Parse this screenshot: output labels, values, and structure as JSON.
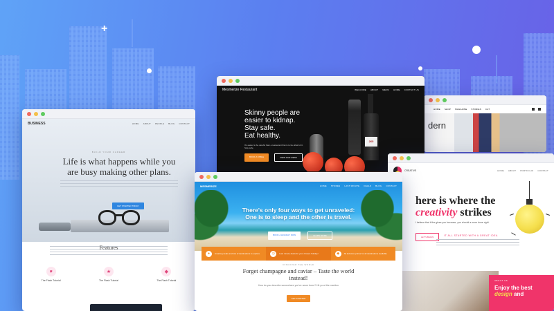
{
  "w1": {
    "logo": "BUSINESS",
    "menu": [
      "HOME",
      "ABOUT",
      "PEOPLE",
      "BLOG",
      "CONTACT"
    ],
    "eyebrow": "BUILD YOUR CAREER",
    "headline": "Life is what happens while you are busy making other plans.",
    "cta": "GET STARTED TODAY",
    "features_title": "Features",
    "features": [
      "The Flash Tutorial",
      "The Flash Tutorial",
      "The Flash Tutorial"
    ]
  },
  "w2": {
    "logo": "Mesmerize Restaurant",
    "menu": [
      "WELCOME",
      "ABOUT",
      "MENU",
      "HOME",
      "CONTACT US"
    ],
    "headline_lines": [
      "Skinny people are",
      "easier to kidnap.",
      "Stay safe.",
      "Eat healthy."
    ],
    "sub": "It's easier to be careful than a restaurant that is to be afraid of it. Stay safe.",
    "btn1": "BOOK A TABLE",
    "btn2": "VIEW OUR MENU",
    "bottle_label": "265"
  },
  "w3": {
    "menu": [
      "HOME",
      "SHOP",
      "MAGAZINE",
      "STORIES",
      "CAT"
    ],
    "partial_text": "dern"
  },
  "w4": {
    "logo": "MESMERIZE",
    "menu": [
      "HOME",
      "STORES",
      "LAST MINUTE",
      "DEALS",
      "BLOG",
      "CONTACT"
    ],
    "headline": "There's only four ways to get unraveled: One is to sleep and the other is travel.",
    "cta1": "BOOK A HOLIDAY NOW",
    "cta2": "LEARN MORE",
    "banner": [
      "Amazing deals and lots of destinations to explore",
      "Last minute deals for your chosen holiday!",
      "All inclusive prices for all destinations available"
    ],
    "eyebrow": "DISCOVER THE WORLD",
    "quote": "Forget champagne and caviar – Taste the world instead!",
    "body": "How do you describe somewhere you've never been? Hit yo at the mention",
    "cta3": "GET STARTED"
  },
  "w5": {
    "logo": "CREATIVE",
    "menu": [
      "HOME",
      "ABOUT",
      "PORTFOLIO",
      "CONTACT"
    ],
    "headline_1": "here is where the",
    "headline_accent": "creativity",
    "headline_2": "strikes",
    "sub": "I believe that it the gives you because, you should a more done right.",
    "cta": "LET'S BEGIN",
    "section_label": "IT ALL STARTED WITH A GREAT IDEA",
    "card_eyebrow": "ABOUT US",
    "card_text_1": "Enjoy the best",
    "card_text_accent": "design",
    "card_text_2": "and"
  },
  "colors": {
    "bg_start": "#5fa3f7",
    "bg_end": "#6a5fe6",
    "accent_blue": "#2f7ef6",
    "accent_orange": "#f08a24",
    "accent_pink": "#f0346a",
    "accent_yellow": "#f5df4d"
  }
}
